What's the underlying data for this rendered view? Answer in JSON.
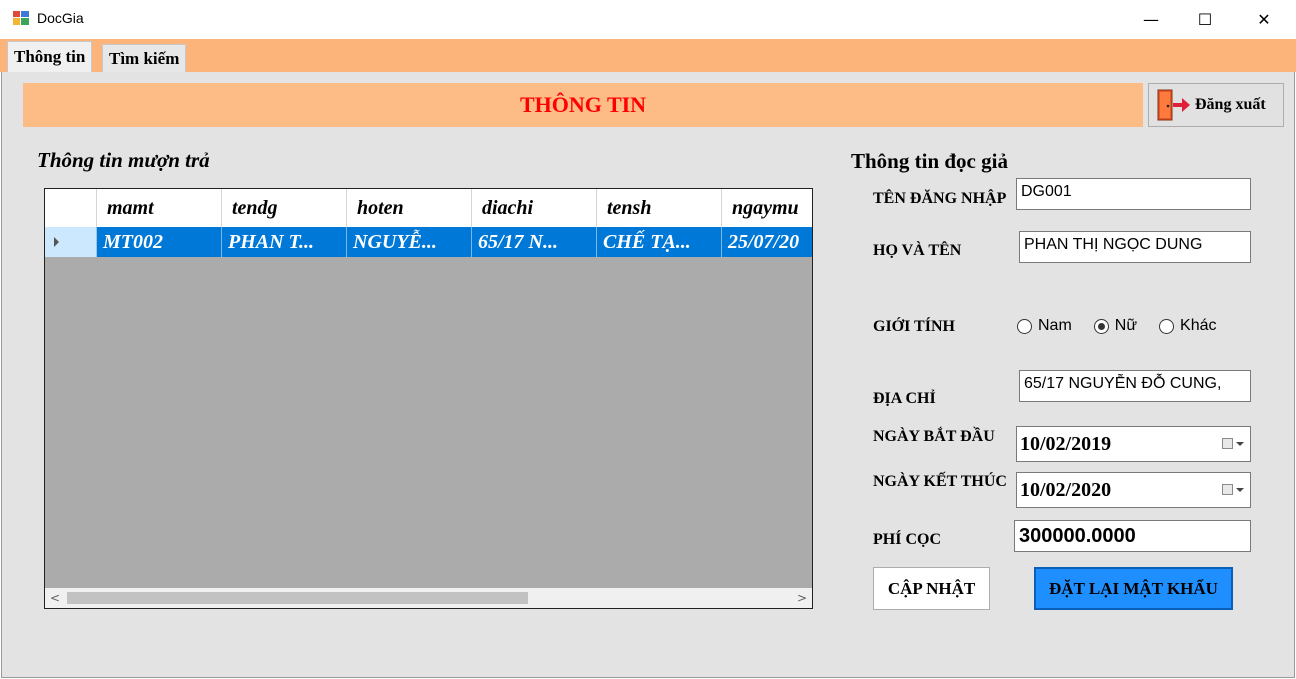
{
  "window": {
    "title": "DocGia",
    "minimize": "—",
    "maximize": "☐",
    "close": "✕"
  },
  "tabs": [
    {
      "label": "Thông tin",
      "active": true
    },
    {
      "label": "Tìm kiếm",
      "active": false
    }
  ],
  "banner": {
    "title": "THÔNG TIN"
  },
  "logout": {
    "label": "Đăng xuất",
    "icon": "logout-door-icon"
  },
  "borrow_section": {
    "title": "Thông tin mượn trả",
    "columns": [
      "mamt",
      "tendg",
      "hoten",
      "diachi",
      "tensh",
      "ngaymu"
    ],
    "rows": [
      [
        "MT002",
        "PHAN T...",
        "NGUYỄ...",
        "65/17 N...",
        "CHẾ TẠ...",
        "25/07/20"
      ]
    ],
    "scroll_left": "<",
    "scroll_right": ">"
  },
  "reader_section": {
    "title": "Thông tin đọc giả",
    "username_label": "TÊN ĐĂNG NHẬP",
    "username_value": "DG001",
    "fullname_label": "HỌ VÀ TÊN",
    "fullname_value": "PHAN THỊ NGỌC DUNG",
    "gender_label": "GIỚI TÍNH",
    "gender_options": [
      "Nam",
      "Nữ",
      "Khác"
    ],
    "gender_selected": "Nữ",
    "address_label": "ĐỊA CHỈ",
    "address_value": "65/17 NGUYỄN ĐỖ CUNG,",
    "start_label": "NGÀY BẮT ĐẦU",
    "start_value": "10/02/2019",
    "end_label": "NGÀY KẾT THÚC",
    "end_value": "10/02/2020",
    "deposit_label": "PHÍ CỌC",
    "deposit_value": "300000.0000",
    "update_button": "CẬP NHẬT",
    "reset_password_button": "ĐẶT LẠI MẬT KHẨU"
  },
  "colors": {
    "accent_orange": "#fdb47a",
    "banner_title": "#ff0000",
    "selection_blue": "#0078d7",
    "reset_button": "#1f8fff"
  }
}
